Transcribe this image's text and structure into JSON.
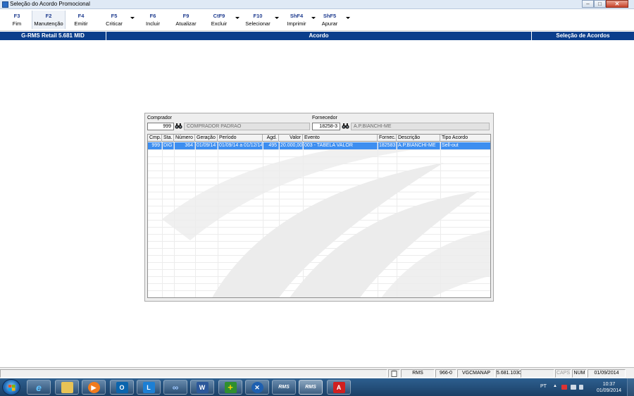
{
  "window": {
    "title": "Seleção do Acordo Promocional",
    "minimize_glyph": "–",
    "maximize_glyph": "□",
    "close_glyph": "✕"
  },
  "toolbar": [
    {
      "key": "F3",
      "label": "Fim"
    },
    {
      "key": "F2",
      "label": "Manutenção"
    },
    {
      "key": "F4",
      "label": "Emitir"
    },
    {
      "key": "F5",
      "label": "Criticar"
    },
    {
      "key": "F6",
      "label": "Incluir"
    },
    {
      "key": "F9",
      "label": "Atualizar"
    },
    {
      "key": "CtF9",
      "label": "Excluir"
    },
    {
      "key": "F10",
      "label": "Selecionar"
    },
    {
      "key": "ShF4",
      "label": "Imprimir"
    },
    {
      "key": "ShF5",
      "label": "Apurar"
    }
  ],
  "header": {
    "left": "G-RMS Retail 5.681 MID",
    "center": "Acordo",
    "right": "Seleção de Acordos"
  },
  "form": {
    "comprador_label": "Comprador",
    "comprador_code": "999",
    "comprador_name": "COMPRADOR PADRAO",
    "fornecedor_label": "Fornecedor",
    "fornecedor_code": "18258-3",
    "fornecedor_name": "A.P.BIANCHI-ME"
  },
  "grid": {
    "columns": [
      "Cmp.",
      "Sta.",
      "Número",
      "Geração",
      "Período",
      "Agd.",
      "Valor",
      "Evento",
      "Fornec.",
      "Descrição",
      "Tipo Acordo"
    ],
    "rows": [
      [
        "999",
        "DIG",
        "364",
        "01/09/14",
        "01/09/14 a 01/12/14",
        "495",
        "20.000,00",
        "003 -  TABELA VALOR",
        "182583",
        "A.P.BIANCHI-ME",
        "Sell-out"
      ]
    ]
  },
  "statusbar": {
    "system": "RMS",
    "code": "966-0",
    "user": "VGCMANAP",
    "version": "5.681.1030",
    "caps": "CAPS",
    "num": "NUM",
    "date": "01/09/2014"
  },
  "taskbar": {
    "apps": [
      "internet-explorer",
      "file-explorer",
      "media-player",
      "outlook",
      "lync",
      "app-infinity",
      "word",
      "app-plus",
      "app-x",
      "rms-1",
      "rms-2",
      "acrobat"
    ],
    "rms_label": "RMS",
    "lang": "PT",
    "time": "10:37",
    "date": "01/09/2014"
  },
  "colors": {
    "header_bg": "#0b3e8c",
    "selected_row": "#3d8ef0",
    "toolbar_key": "#1f3c8f"
  }
}
